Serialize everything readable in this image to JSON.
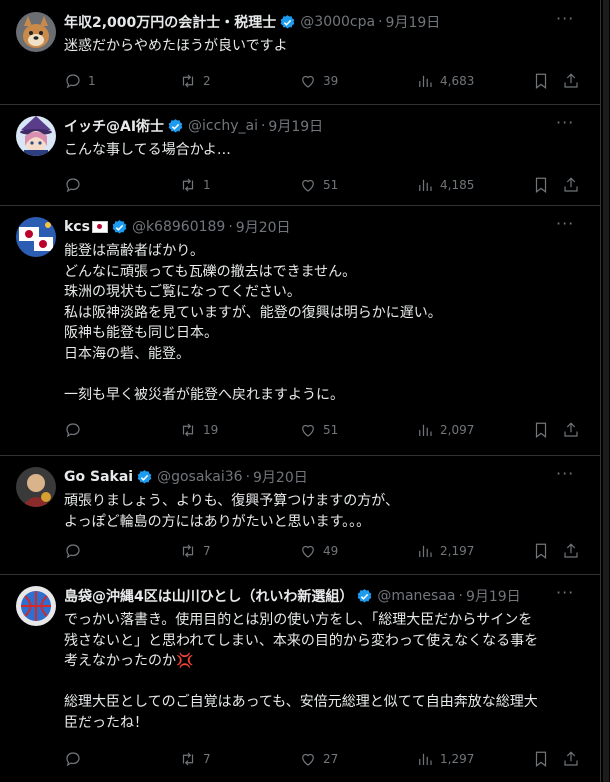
{
  "tweets": [
    {
      "name": "年収2,000万円の会計士・税理士",
      "handle": "@3000cpa",
      "date": "9月19日",
      "text": "迷惑だからやめたほうが良いですよ",
      "replies": "1",
      "retweets": "2",
      "likes": "39",
      "views": "4,683",
      "avatar": "dog-avatar"
    },
    {
      "name": "イッチ@AI術士",
      "handle": "@icchy_ai",
      "date": "9月19日",
      "text": "こんな事してる場合かよ…",
      "replies": "",
      "retweets": "1",
      "likes": "51",
      "views": "4,185",
      "avatar": "anime-avatar"
    },
    {
      "name": "kcs",
      "handle": "@k68960189",
      "date": "9月20日",
      "text": "能登は高齢者ばかり。\nどんなに頑張っても瓦礫の撤去はできません。\n珠洲の現状もご覧になってください。\n私は阪神淡路を見ていますが、能登の復興は明らかに遅い。\n阪神も能登も同じ日本。\n日本海の砦、能登。\n\n一刻も早く被災者が能登へ戻れますように。",
      "replies": "",
      "retweets": "19",
      "likes": "51",
      "views": "2,097",
      "avatar": "flag-avatar"
    },
    {
      "name": "Go Sakai",
      "handle": "@gosakai36",
      "date": "9月20日",
      "text": "頑張りましょう、よりも、復興予算つけますの方が、\nよっぽど輪島の方にはありがたいと思います。。。",
      "replies": "",
      "retweets": "7",
      "likes": "49",
      "views": "2,197",
      "avatar": "photo-avatar"
    },
    {
      "name": "島袋@沖縄4区は山川ひとし（れいわ新選組）",
      "handle": "@manesaa",
      "date": "9月19日",
      "text_lines": [
        "でっかい落書き。使用目的とは別の使い方をし、「総理大臣だからサインを",
        "残さないと」と思われてしまい、本来の目的から変わって使えなくなる事を",
        "考えなかったのか",
        "",
        "総理大臣としてのご自覚はあっても、安倍元総理と似てて自由奔放な総理大",
        "臣だったね！"
      ],
      "replies": "",
      "retweets": "7",
      "likes": "27",
      "views": "1,297",
      "avatar": "ball-avatar"
    }
  ],
  "colors": {
    "background": "#000000",
    "text": "#e7e9ea",
    "muted": "#71767b",
    "verified": "#1d9bf0",
    "border": "#2f3336"
  },
  "icons": [
    "reply-icon",
    "retweet-icon",
    "like-icon",
    "views-icon",
    "bookmark-icon",
    "share-icon",
    "more-icon",
    "verified-badge-icon"
  ]
}
